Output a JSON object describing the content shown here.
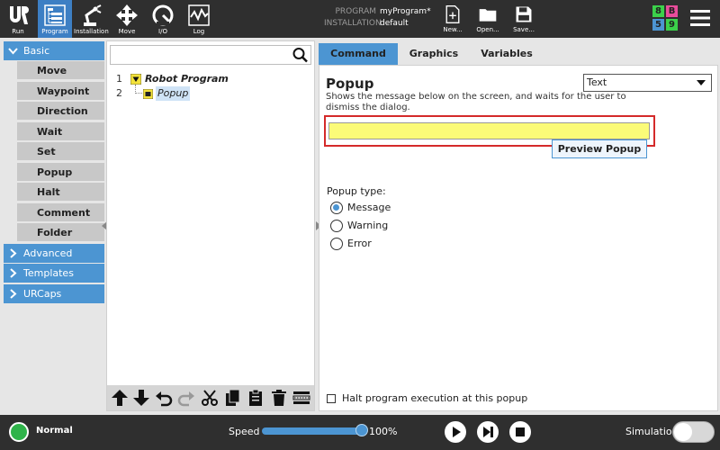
{
  "topbar": {
    "buttons": [
      {
        "label": "Run",
        "icon": "ur-logo-icon"
      },
      {
        "label": "Program",
        "icon": "program-tree-icon",
        "active": true
      },
      {
        "label": "Installation",
        "icon": "robot-arm-icon"
      },
      {
        "label": "Move",
        "icon": "move-arrows-icon"
      },
      {
        "label": "I/O",
        "icon": "io-gauge-icon"
      },
      {
        "label": "Log",
        "icon": "log-chart-icon"
      }
    ],
    "program_key": "PROGRAM",
    "program_value": "myProgram*",
    "installation_key": "INSTALLATION",
    "installation_value": "default",
    "file_buttons": [
      {
        "label": "New...",
        "icon": "new-file-icon"
      },
      {
        "label": "Open...",
        "icon": "folder-icon"
      },
      {
        "label": "Save...",
        "icon": "save-icon"
      }
    ],
    "badges": [
      {
        "text": "8",
        "color": "#3bd14a"
      },
      {
        "text": "B",
        "color": "#e84c9b"
      },
      {
        "text": "5",
        "color": "#4c95d2"
      },
      {
        "text": "9",
        "color": "#3bd14a"
      }
    ]
  },
  "leftnav": {
    "basic_label": "Basic",
    "basic_items": [
      "Move",
      "Waypoint",
      "Direction",
      "Wait",
      "Set",
      "Popup",
      "Halt",
      "Comment",
      "Folder"
    ],
    "advanced_label": "Advanced",
    "templates_label": "Templates",
    "urcaps_label": "URCaps"
  },
  "tree": {
    "search_placeholder": "",
    "rows": [
      {
        "num": "1",
        "label": "Robot Program"
      },
      {
        "num": "2",
        "label": "Popup"
      }
    ]
  },
  "tabs": [
    "Command",
    "Graphics",
    "Variables"
  ],
  "command": {
    "title": "Popup",
    "type_value": "Text",
    "description": "Shows the message below on the screen, and waits for the user to dismiss the dialog.",
    "message_value": "",
    "preview_label": "Preview Popup",
    "popup_type_label": "Popup type:",
    "popup_types": [
      "Message",
      "Warning",
      "Error"
    ],
    "selected_type": "Message",
    "halt_label": "Halt program execution at this popup"
  },
  "footer": {
    "status": "Normal",
    "speed_label": "Speed",
    "speed_value": "100%",
    "speed_fraction": 1.0,
    "simulation_label": "Simulation"
  },
  "colors": {
    "accent": "#4c95d2",
    "topbar": "#2f2f2f",
    "message_field": "#fbfb78",
    "highlight_border": "#d42a2a",
    "status_ok": "#2fb34a"
  }
}
